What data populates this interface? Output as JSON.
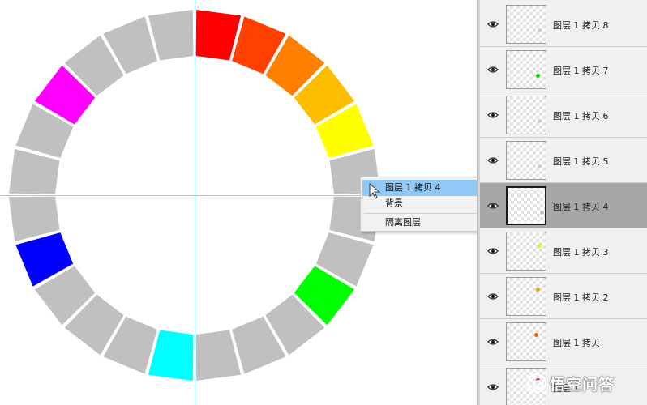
{
  "canvas": {
    "segment_colors": [
      "#ff0000",
      "#ff4000",
      "#ff7f00",
      "#ffbf00",
      "#ffff00",
      "#c0c0c0",
      "#c0c0c0",
      "#c0c0c0",
      "#00ff00",
      "#c0c0c0",
      "#c0c0c0",
      "#c0c0c0",
      "#00ffff",
      "#c0c0c0",
      "#c0c0c0",
      "#c0c0c0",
      "#0000ff",
      "#c0c0c0",
      "#c0c0c0",
      "#c0c0c0",
      "#ff00ff",
      "#c0c0c0",
      "#c0c0c0",
      "#c0c0c0"
    ],
    "guide_color": "#7fd8e6"
  },
  "context_menu": {
    "items": [
      {
        "label": "图层 1 拷贝 4",
        "highlighted": true
      },
      {
        "label": "背景",
        "highlighted": false
      },
      {
        "label": "隔离图层",
        "highlighted": false
      }
    ]
  },
  "layers": [
    {
      "name": "图层 1 拷贝 8",
      "visible": true,
      "selected": false,
      "swatch": "#d0d0d0"
    },
    {
      "name": "图层 1 拷贝 7",
      "visible": true,
      "selected": false,
      "swatch": "#00dd00"
    },
    {
      "name": "图层 1 拷贝 6",
      "visible": true,
      "selected": false,
      "swatch": "#d0d0d0"
    },
    {
      "name": "图层 1 拷贝 5",
      "visible": true,
      "selected": false,
      "swatch": "#d0d0d0"
    },
    {
      "name": "图层 1 拷贝 4",
      "visible": true,
      "selected": true,
      "swatch": "#c8c8c8"
    },
    {
      "name": "图层 1 拷贝 3",
      "visible": true,
      "selected": false,
      "swatch": "#f2f200"
    },
    {
      "name": "图层 1 拷贝 2",
      "visible": true,
      "selected": false,
      "swatch": "#e6b000"
    },
    {
      "name": "图层 1 拷贝",
      "visible": true,
      "selected": false,
      "swatch": "#e07000"
    },
    {
      "name": "图层 1",
      "visible": true,
      "selected": false,
      "swatch": "#e00000"
    }
  ],
  "watermark": {
    "text": "悟空问答",
    "icon": "wukong-logo-icon"
  }
}
